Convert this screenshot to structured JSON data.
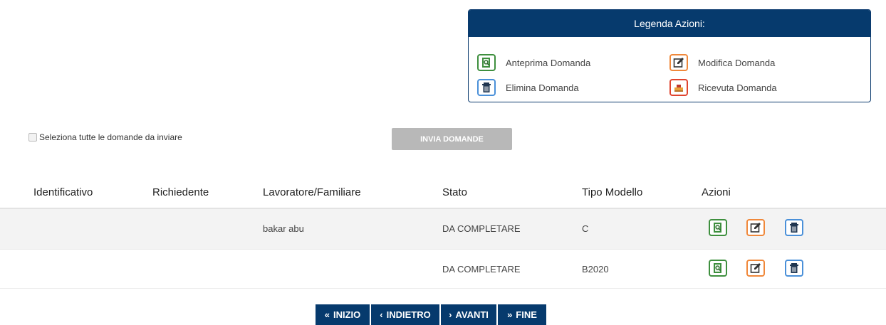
{
  "legend": {
    "title": "Legenda Azioni:",
    "items": [
      {
        "label": "Anteprima Domanda",
        "icon": "preview-icon",
        "color": "#3e8f3e"
      },
      {
        "label": "Modifica Domanda",
        "icon": "edit-icon",
        "color": "#f0883a"
      },
      {
        "label": "Elimina Domanda",
        "icon": "trash-icon",
        "color": "#4a90d9"
      },
      {
        "label": "Ricevuta Domanda",
        "icon": "receipt-icon",
        "color": "#e0442f"
      }
    ]
  },
  "select_all": {
    "label": "Seleziona tutte le domande da inviare",
    "checked": false
  },
  "send_button": {
    "label": "INVIA DOMANDE"
  },
  "table": {
    "columns": [
      "Identificativo",
      "Richiedente",
      "Lavoratore/Familiare",
      "Stato",
      "Tipo Modello",
      "Azioni"
    ],
    "rows": [
      {
        "identificativo": "",
        "richiedente": "",
        "lavoratore": "bakar abu",
        "stato": "DA COMPLETARE",
        "tipo": "C"
      },
      {
        "identificativo": "",
        "richiedente": "",
        "lavoratore": "",
        "stato": "DA COMPLETARE",
        "tipo": "B2020"
      }
    ]
  },
  "pagination": {
    "first": "INIZIO",
    "prev": "INDIETRO",
    "next": "AVANTI",
    "last": "FINE"
  },
  "colors": {
    "primary": "#063a6d",
    "disabled": "#b8b8b8"
  }
}
